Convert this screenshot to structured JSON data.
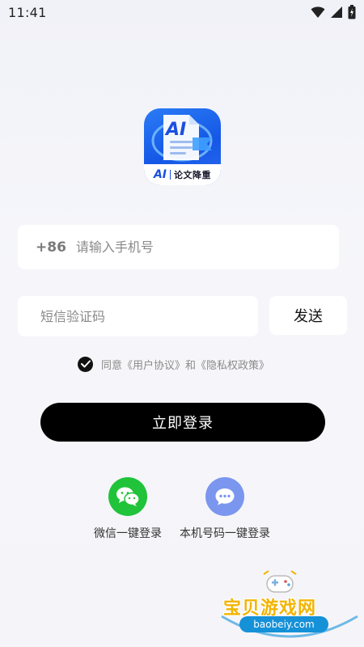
{
  "status_bar": {
    "time": "11:41"
  },
  "app_logo": {
    "ai_text": "AI",
    "caption_ai": "AI",
    "caption_text": "论文降重"
  },
  "login_form": {
    "country_code": "+86",
    "phone_placeholder": "请输入手机号",
    "code_placeholder": "短信验证码",
    "send_label": "发送",
    "login_label": "立即登录"
  },
  "agreement": {
    "prefix": "同意",
    "user_agreement": "《用户协议》",
    "conjunction": "和",
    "privacy_policy": "《隐私权政策》",
    "checked": true
  },
  "quick_login": [
    {
      "label": "微信一键登录",
      "icon": "wechat-icon"
    },
    {
      "label": "本机号码一键登录",
      "icon": "chat-bubble-icon"
    }
  ],
  "watermark": {
    "title": "宝贝游戏网",
    "url": "baobeiy.com"
  },
  "colors": {
    "primary_button": "#000000",
    "wechat": "#20c33a",
    "onekey": "#7b96ee",
    "logo_blue": "#1b4fe0"
  }
}
